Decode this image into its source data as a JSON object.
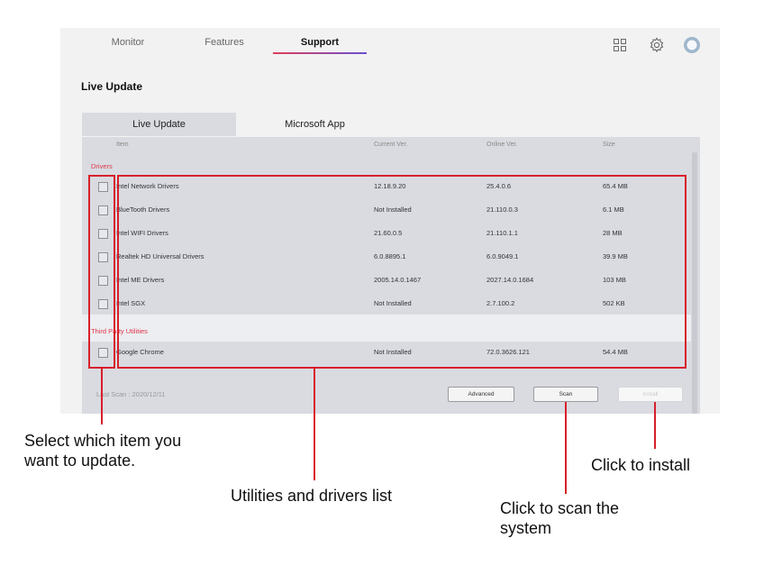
{
  "nav": {
    "tabs": [
      "Monitor",
      "Features",
      "Support"
    ],
    "active_tab": "Support",
    "icons": [
      "grid-icon",
      "gear-icon",
      "avatar"
    ]
  },
  "page_title": "Live Update",
  "subtabs": [
    "Live Update",
    "Microsoft App"
  ],
  "table": {
    "headers": [
      "Item",
      "Current Ver.",
      "Online Ver.",
      "Size"
    ],
    "sections": [
      {
        "label": "Drivers",
        "rows": [
          {
            "item": "Intel Network Drivers",
            "current": "12.18.9.20",
            "online": "25.4.0.6",
            "size": "65.4 MB"
          },
          {
            "item": "BlueTooth Drivers",
            "current": "Not Installed",
            "online": "21.110.0.3",
            "size": "6.1 MB"
          },
          {
            "item": "Intel WIFI Drivers",
            "current": "21.60.0.5",
            "online": "21.110.1.1",
            "size": "28 MB"
          },
          {
            "item": "Realtek HD Universal Drivers",
            "current": "6.0.8895.1",
            "online": "6.0.9049.1",
            "size": "39.9 MB"
          },
          {
            "item": "Intel ME Drivers",
            "current": "2005.14.0.1467",
            "online": "2027.14.0.1684",
            "size": "103 MB"
          },
          {
            "item": "Intel SGX",
            "current": "Not Installed",
            "online": "2.7.100.2",
            "size": "502 KB"
          }
        ]
      },
      {
        "label": "Third Party Utilities",
        "rows": [
          {
            "item": "Google Chrome",
            "current": "Not Installed",
            "online": "72.0.3626.121",
            "size": "54.4 MB"
          }
        ]
      }
    ]
  },
  "footer": {
    "last_scan": "Last Scan : 2020/12/11",
    "advanced_label": "Advanced",
    "scan_label": "Scan",
    "install_label": "Install"
  },
  "callouts": {
    "select": [
      "Select which item you",
      "want to update."
    ],
    "list": "Utilities and drivers list",
    "scan": [
      "Click to scan the",
      "system"
    ],
    "install": "Click to install"
  },
  "colors": {
    "accent_red": "#d81f2a",
    "section_red": "#e0364a",
    "panel_bg": "#d9dbe1"
  }
}
